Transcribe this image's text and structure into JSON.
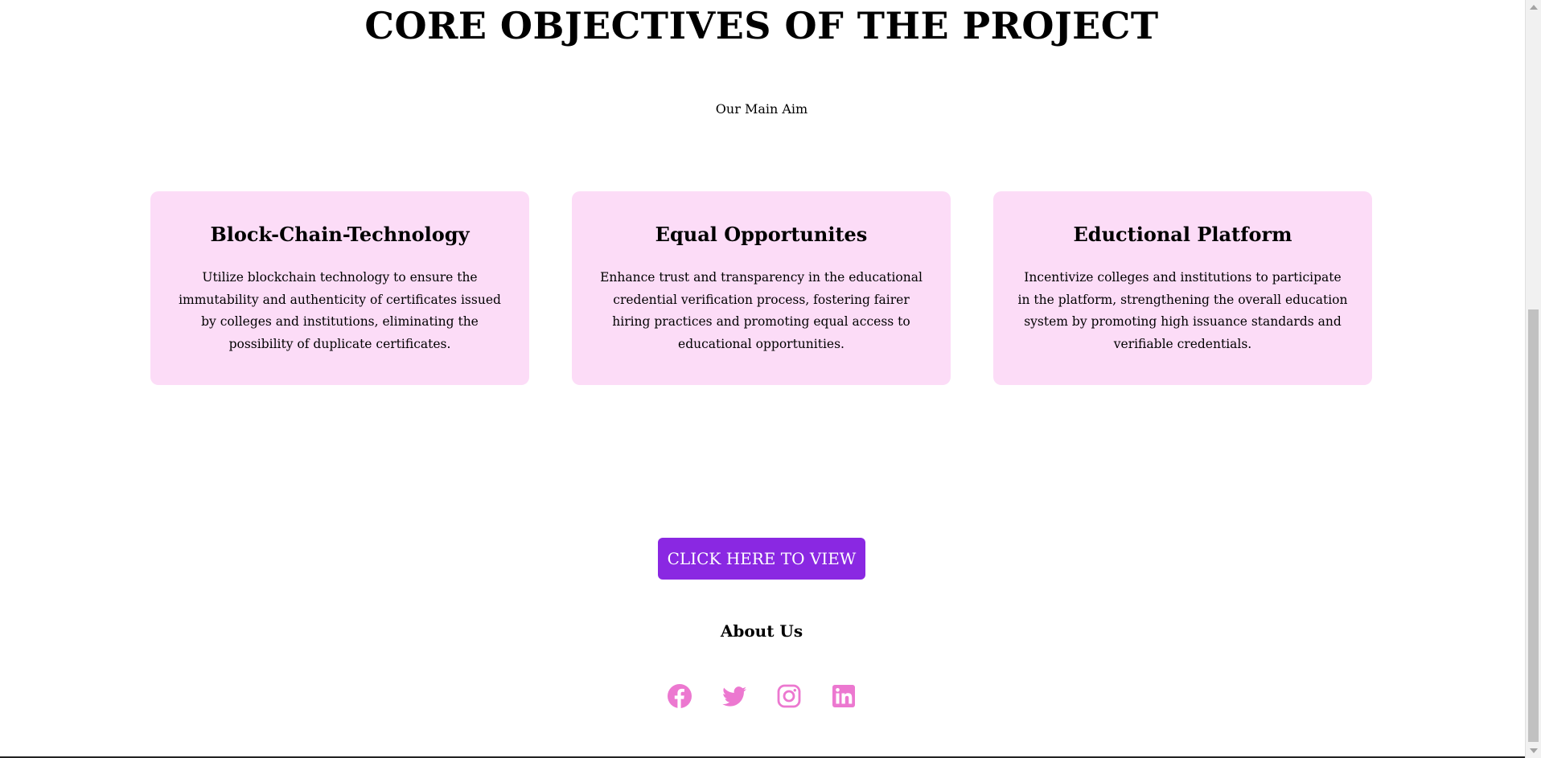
{
  "header": {
    "title": "CORE OBJECTIVES OF THE PROJECT",
    "subtitle": "Our Main Aim"
  },
  "cards": [
    {
      "title": "Block-Chain-Technology",
      "text": "Utilize blockchain technology to ensure the immutability and authenticity of certificates issued by colleges and institutions, eliminating the possibility of duplicate certificates."
    },
    {
      "title": "Equal Opportunites",
      "text": "Enhance trust and transparency in the educational credential verification process, fostering fairer hiring practices and promoting equal access to educational opportunities."
    },
    {
      "title": "Eductional Platform",
      "text": "Incentivize colleges and institutions to participate in the platform, strengthening the overall education system by promoting high issuance standards and verifiable credentials."
    }
  ],
  "cta": {
    "label": "CLICK HERE TO VIEW"
  },
  "footer": {
    "about_label": "About Us",
    "social_icons": [
      "facebook-icon",
      "twitter-icon",
      "instagram-icon",
      "linkedin-icon"
    ]
  },
  "colors": {
    "card_background": "#fcdcf7",
    "button_background": "#8a28e2",
    "social_icon": "#ec78d0"
  }
}
